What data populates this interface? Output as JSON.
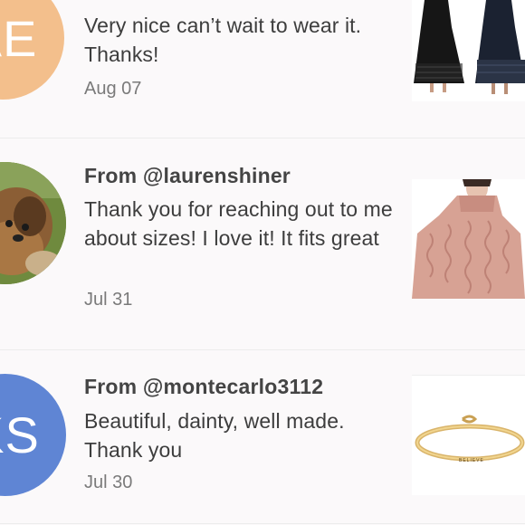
{
  "reviews": [
    {
      "avatar_initials": "AE",
      "avatar_color": "#f3bf8c",
      "sender": "",
      "message": "Very nice can’t wait to wear it. Thanks!",
      "date": "Aug 07",
      "product_icon": "black-maxi-dress-photo"
    },
    {
      "avatar_initials": "",
      "avatar_color": "#6f8a3e",
      "sender": "From @laurenshiner",
      "message": "Thank you for reaching out to me about sizes! I love it! It fits great",
      "date": "Jul 31",
      "product_icon": "pink-knit-sweater-photo"
    },
    {
      "avatar_initials": "KS",
      "avatar_color": "#5f85d4",
      "sender": "From @montecarlo3112",
      "message": "Beautiful, dainty, well made. Thank you",
      "date": "Jul 30",
      "product_icon": "gold-bracelet-photo",
      "product_engraving": "BELIEVE"
    }
  ]
}
